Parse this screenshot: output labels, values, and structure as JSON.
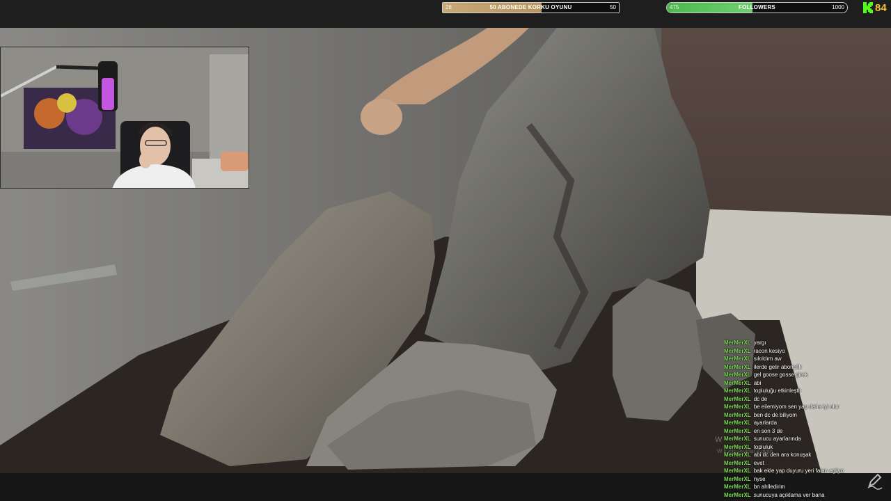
{
  "goals": {
    "subscriber": {
      "current": "28",
      "title": "50 ABONEDE KORKU OYUNU",
      "max": "50",
      "progress_fraction": 0.56,
      "color": "#c9a878"
    },
    "followers": {
      "current": "475",
      "title": "FOLLOWERS",
      "max": "1000",
      "progress_fraction": 0.475,
      "color": "#4cb84c"
    }
  },
  "kick": {
    "icon": "kick-logo-icon",
    "viewer_count": "84",
    "color": "#53fc18",
    "count_color": "#f2c230"
  },
  "chat": {
    "username_color": "#7fdc5a",
    "messages": [
      {
        "user": "MerMerXL",
        "text": "yargı"
      },
      {
        "user": "MerMerXL",
        "text": "racon kesiyo"
      },
      {
        "user": "MerMerXL",
        "text": "sıkıldım aw"
      },
      {
        "user": "MerMerXL",
        "text": "ilerde gelir abonelik"
      },
      {
        "user": "MerMerXL",
        "text": "gel goose gosse girek"
      },
      {
        "user": "MerMerXL",
        "text": "abi"
      },
      {
        "user": "MerMerXL",
        "text": "topluluğu etkinleştir"
      },
      {
        "user": "MerMerXL",
        "text": "dc de"
      },
      {
        "user": "MerMerXL",
        "text": "be eilemiyom sen yap daha iyi olur"
      },
      {
        "user": "MerMerXL",
        "text": "ben dc de biliyom"
      },
      {
        "user": "MerMerXL",
        "text": "ayarlarda"
      },
      {
        "user": "MerMerXL",
        "text": "en son 3 de"
      },
      {
        "user": "MerMerXL",
        "text": "sunucu ayarlarında"
      },
      {
        "user": "MerMerXL",
        "text": "topluluk"
      },
      {
        "user": "MerMerXL",
        "text": "abi dc den ara konuşak"
      },
      {
        "user": "MerMerXL",
        "text": "evet"
      },
      {
        "user": "MerMerXL",
        "text": "bak ekle yap duyuru yeri falan egliyo"
      },
      {
        "user": "MerMerXL",
        "text": "nyse"
      },
      {
        "user": "MerMerXL",
        "text": "bn ahlledirim"
      },
      {
        "user": "MerMerXL",
        "text": "sunucuya açıklama ver bana"
      }
    ]
  },
  "windows_watermark": {
    "line1": "W",
    "line2": "W                    k için Ayarlar'a gidin."
  },
  "bottom_icon": "pen-icon"
}
